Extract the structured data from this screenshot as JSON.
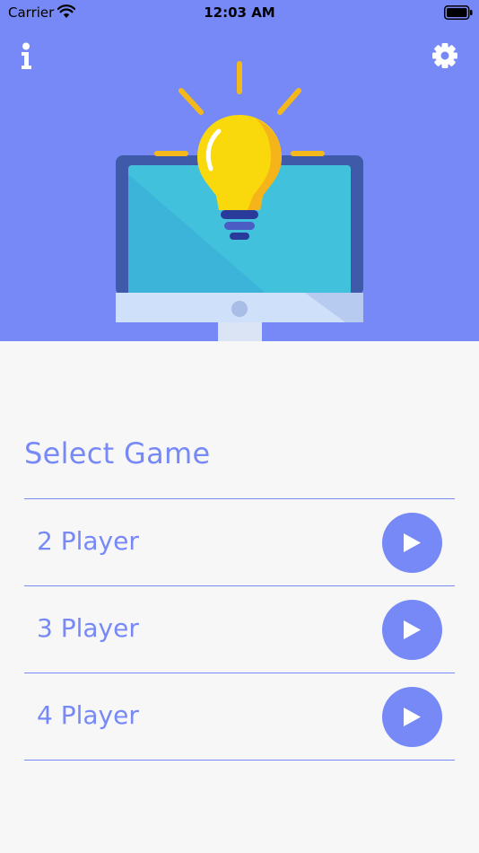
{
  "status_bar": {
    "carrier": "Carrier",
    "time": "12:03 AM"
  },
  "header": {
    "background_color": "#7689f7",
    "left_icon": "info-icon",
    "right_icon": "gear-icon",
    "illustration": "lightbulb-over-monitor"
  },
  "main": {
    "title": "Select Game",
    "accent_color": "#7689f7",
    "games": [
      {
        "label": "2 Player",
        "icon": "play-icon"
      },
      {
        "label": "3 Player",
        "icon": "play-icon"
      },
      {
        "label": "4 Player",
        "icon": "play-icon"
      }
    ]
  }
}
